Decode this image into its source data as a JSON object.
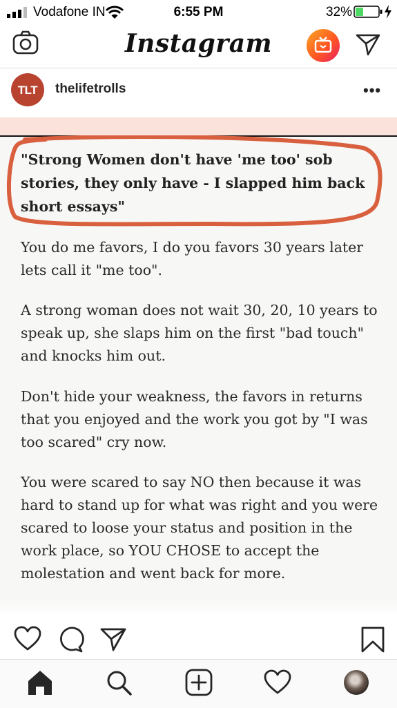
{
  "status_bar": {
    "carrier": "Vodafone IN",
    "time": "6:55 PM",
    "battery": "32%"
  },
  "app": {
    "logo": "Instagram",
    "icons": {
      "camera": "camera-icon",
      "igtv": "igtv-icon",
      "direct": "paper-plane-icon"
    }
  },
  "post": {
    "username": "thelifetrolls",
    "avatar_text": "TLT",
    "more": "•••",
    "image": {
      "quote": "\"Strong Women don't have 'me too' sob stories, they only have - I slapped him back short essays\"",
      "paragraphs": [
        "You do me favors, I do you favors 30 years later lets call it \"me too\".",
        "A strong woman does not wait 30, 20, 10 years to speak up, she slaps him on the first \"bad touch\" and knocks him out.",
        "Don't hide your weakness, the favors in returns that you enjoyed and the work you got by \"I was too scared\" cry now.",
        "You were scared to say NO then because it was hard to stand up for what was right and you were scared to loose your status and position in the work place, so YOU CHOSE to accept the molestation and went back for more."
      ]
    },
    "actions": [
      "heart-icon",
      "comment-icon",
      "share-icon",
      "bookmark-icon"
    ]
  },
  "tab_bar": [
    "home-icon",
    "search-icon",
    "new-post-icon",
    "activity-icon",
    "profile-avatar"
  ],
  "colors": {
    "accent_circle": "#d9603f",
    "battery_fill": "#4cd964",
    "avatar_bg": "#b8432f",
    "pink_strip": "#fbe3dc"
  }
}
